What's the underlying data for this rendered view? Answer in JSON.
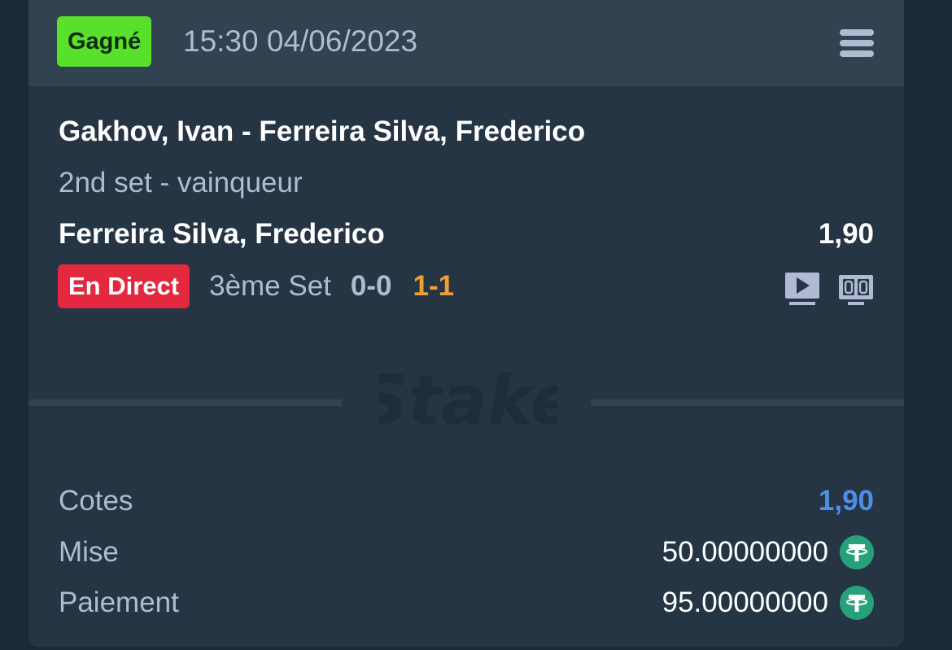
{
  "header": {
    "status": "Gagné",
    "datetime": "15:30 04/06/2023"
  },
  "bet": {
    "match": "Gakhov, Ivan - Ferreira Silva, Frederico",
    "market": "2nd set - vainqueur",
    "selection": "Ferreira Silva, Frederico",
    "selection_odds": "1,90"
  },
  "live": {
    "badge": "En Direct",
    "set_label": "3ème Set",
    "score_sets": "0-0",
    "score_games": "1-1"
  },
  "summary": {
    "odds_label": "Cotes",
    "odds_value": "1,90",
    "stake_label": "Mise",
    "stake_value": "50.00000000",
    "payout_label": "Paiement",
    "payout_value": "95.00000000",
    "currency_icon": "tether-icon"
  },
  "icons": {
    "menu": "menu-icon",
    "stream": "live-stream-icon",
    "scoreboard": "scoreboard-icon"
  },
  "colors": {
    "won": "#58e02a",
    "live": "#e3283f",
    "score_highlight": "#f0a030",
    "odds": "#4f8ee8"
  }
}
